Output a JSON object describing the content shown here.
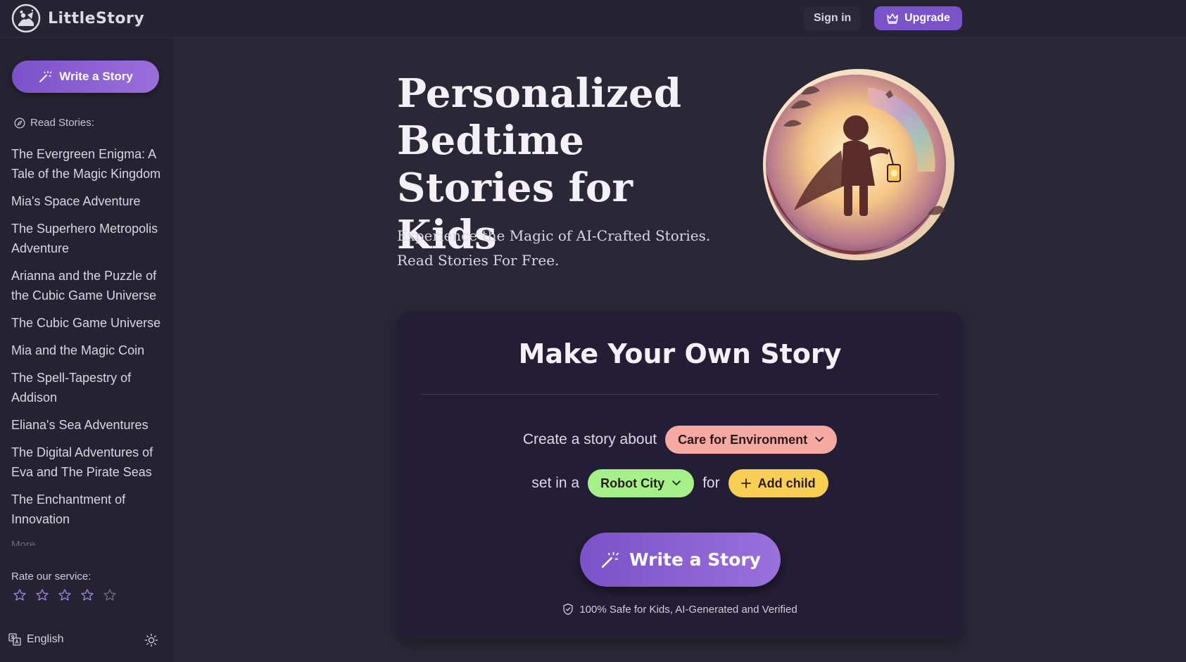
{
  "header": {
    "app_name": "LittleStory",
    "signin_label": "Sign in",
    "upgrade_label": "Upgrade"
  },
  "sidebar": {
    "write_label": "Write a Story",
    "read_label": "Read Stories:",
    "stories": [
      "The Evergreen Enigma: A Tale of the Magic Kingdom",
      "Mia's Space Adventure",
      "The Superhero Metropolis Adventure",
      "Arianna and the Puzzle of the Cubic Game Universe",
      "The Cubic Game Universe",
      "Mia and the Magic Coin",
      "The Spell-Tapestry of Addison",
      "Eliana's Sea Adventures",
      "The Digital Adventures of Eva and The Pirate Seas",
      "The Enchantment of Innovation"
    ],
    "more_label": "More",
    "rate_label": "Rate our service:",
    "rating_max": 5,
    "language": "English"
  },
  "hero": {
    "title": "Personalized Bedtime Stories for Kids",
    "subtitle_line1": "Experience the Magic of AI-Crafted Stories.",
    "subtitle_line2": "Read Stories For Free."
  },
  "card": {
    "title": "Make Your Own Story",
    "prefix_about": "Create a story about",
    "topic": "Care for Environment",
    "prefix_set": "set in a",
    "place": "Robot City",
    "prefix_for": "for",
    "add_child_label": "Add child",
    "write_label": "Write a Story",
    "safety_note": "100% Safe for Kids, AI-Generated and Verified"
  },
  "colors": {
    "accent": "#7b52c8",
    "topic_pill": "#f6a9a0",
    "place_pill": "#a6f08a",
    "child_pill": "#f8cf52"
  }
}
